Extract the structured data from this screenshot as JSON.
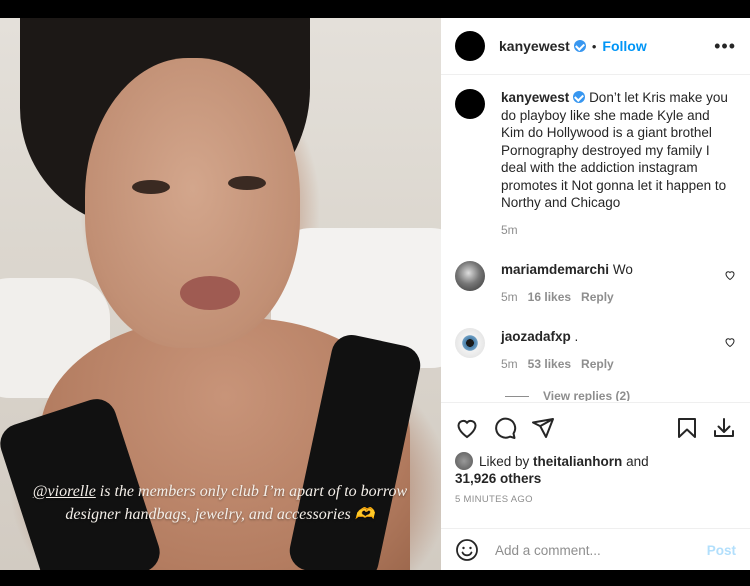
{
  "post": {
    "caption_overlay": {
      "mention": "@viorelle",
      "text": " is the members only club I’m apart of to borrow designer handbags, jewelry, and accessories 🫶"
    },
    "header": {
      "username": "kanyewest",
      "separator": "•",
      "follow_label": "Follow",
      "more_label": "•••"
    },
    "comments": [
      {
        "username": "kanyewest",
        "text": "Don’t let Kris make you do playboy like she made Kyle and Kim do Hollywood is a giant brothel Pornography destroyed my family I deal with the addiction instagram promotes it Not gonna let it happen to Northy and Chicago",
        "time": "5m"
      },
      {
        "username": "mariamdemarchi",
        "text": "Wo",
        "time": "5m",
        "likes": "16 likes",
        "reply_label": "Reply"
      },
      {
        "username": "jaozadafxp",
        "text": ".",
        "time": "5m",
        "likes": "53 likes",
        "reply_label": "Reply",
        "view_replies": "View replies (2)"
      }
    ],
    "likes_line": {
      "prefix": "Liked by ",
      "user": "theitalianhorn",
      "middle": " and",
      "others": "31,926 others"
    },
    "timestamp": "5 MINUTES AGO",
    "add_comment": {
      "placeholder": "Add a comment...",
      "post_label": "Post"
    },
    "icons": {
      "like": "heart-icon",
      "comment": "comment-icon",
      "share": "send-icon",
      "save": "bookmark-icon",
      "download": "download-icon",
      "emoji": "emoji-icon"
    },
    "colors": {
      "accent": "#0095f6",
      "verified": "#3897f0",
      "muted": "#8e8e8e",
      "post_disabled": "#b2dffc"
    }
  }
}
